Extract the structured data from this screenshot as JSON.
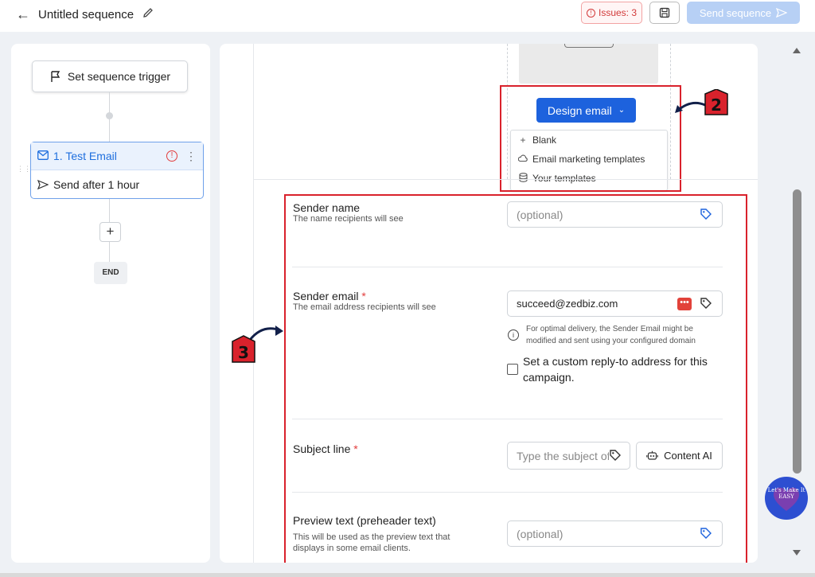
{
  "header": {
    "title": "Untitled sequence",
    "issues_label": "Issues: 3",
    "send_label": "Send sequence"
  },
  "flow": {
    "trigger_label": "Set sequence trigger",
    "step_title": "1. Test Email",
    "step_delay_prefix": "Send ",
    "step_delay_value": "after 1 hour",
    "end_label": "END"
  },
  "design": {
    "button_label": "Design email",
    "menu_items": [
      "Blank",
      "Email marketing templates",
      "Your templates"
    ]
  },
  "form": {
    "sender_name_label": "Sender name",
    "sender_name_sub": "The name recipients will see",
    "sender_name_placeholder": "(optional)",
    "sender_email_label": "Sender email",
    "sender_email_sub": "The email address recipients will see",
    "sender_email_value": "succeed@zedbiz.com",
    "info_text": "For optimal delivery, the Sender Email might be modified and sent using your configured domain",
    "reply_to_label": "Set a custom reply-to address for this campaign.",
    "subject_label": "Subject line",
    "subject_placeholder": "Type the subject of",
    "content_ai_label": "Content AI",
    "preview_label": "Preview text (preheader text)",
    "preview_sub": "This will be used as the preview text that displays in some email clients.",
    "preview_placeholder": "(optional)",
    "required_mark": "*"
  },
  "annotations": {
    "marker_2": "2",
    "marker_3": "3",
    "brand_text": "Let's Make It EASY"
  },
  "colors": {
    "primary": "#1d62dd",
    "annotation_red": "#d9222c",
    "issue_red": "#d23a3a"
  },
  "icons": [
    "back-arrow-icon",
    "pencil-icon",
    "alert-icon",
    "save-icon",
    "send-icon",
    "flag-icon",
    "mail-icon",
    "kebab-icon",
    "send-plane-icon",
    "plus-icon",
    "chevron-down-icon",
    "cloud-icon",
    "database-icon",
    "tag-icon",
    "info-icon",
    "robot-icon"
  ]
}
